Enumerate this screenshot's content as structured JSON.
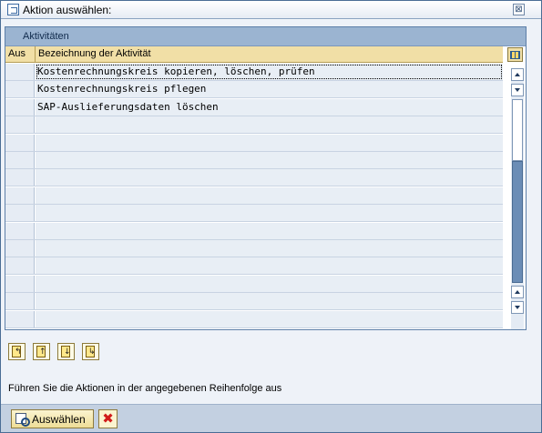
{
  "dialog": {
    "title": "Aktion auswählen:",
    "close_glyph": "⊠"
  },
  "table": {
    "title": "Aktivitäten",
    "columns": [
      "Aus",
      "Bezeichnung der Aktivität"
    ],
    "rows": [
      "Kostenrechnungskreis kopieren, löschen, prüfen",
      "Kostenrechnungskreis pflegen",
      "SAP-Auslieferungsdaten löschen",
      "",
      "",
      "",
      "",
      "",
      "",
      "",
      "",
      "",
      "",
      "",
      ""
    ],
    "focused_row": 0
  },
  "toolbar": {
    "icons": [
      "insert-first-icon",
      "move-up-icon",
      "move-down-icon",
      "insert-last-icon"
    ],
    "arrows": [
      "↰",
      "↑",
      "↓",
      "↳"
    ]
  },
  "hint": "Führen Sie die Aktionen in der angegebenen Reihenfolge aus",
  "footer": {
    "select_label": "Auswählen",
    "cancel_glyph": "✖"
  }
}
